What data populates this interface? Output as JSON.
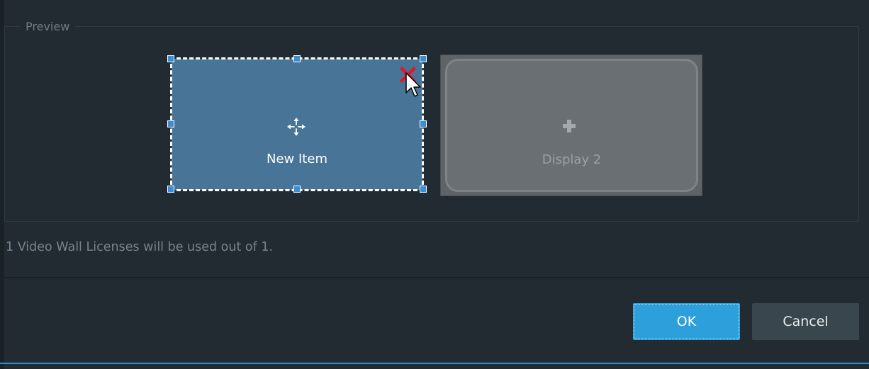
{
  "preview": {
    "title": "Preview",
    "items": [
      {
        "label": "New Item",
        "icon": "move-icon",
        "selected": true
      },
      {
        "label": "Display 2",
        "icon": "plus-icon",
        "selected": false
      }
    ]
  },
  "license_text": "1 Video Wall Licenses will be used out of 1.",
  "buttons": {
    "ok": "OK",
    "cancel": "Cancel"
  },
  "colors": {
    "background": "#222b31",
    "item_selected": "#487497",
    "display_empty": "#696f72",
    "accent": "#2d9fdb",
    "remove": "#e0182a"
  }
}
